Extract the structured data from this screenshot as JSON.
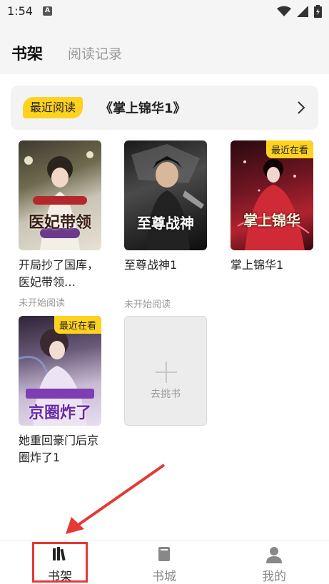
{
  "status_bar": {
    "time": "1:54",
    "notif_letter": "A"
  },
  "header": {
    "tab_active": "书架",
    "tab_inactive": "阅读记录"
  },
  "recent": {
    "badge": "最近阅读",
    "book_title": "《掌上锦华1》"
  },
  "books": [
    {
      "title": "开局抄了国库，医妃带领…",
      "status": "未开始阅读",
      "cover_text": "医妃带领",
      "badge": ""
    },
    {
      "title": "至尊战神1",
      "status": "未开始阅读",
      "cover_text": "至尊战神",
      "badge": ""
    },
    {
      "title": "掌上锦华1",
      "status": "",
      "cover_text": "掌上锦华",
      "badge": "最近在看"
    },
    {
      "title": "她重回豪门后京圈炸了1",
      "status": "",
      "cover_text": "京圈炸了",
      "badge": "最近在看"
    }
  ],
  "add_book": {
    "label": "去挑书"
  },
  "bottom_nav": [
    {
      "label": "书架"
    },
    {
      "label": "书城"
    },
    {
      "label": "我的"
    }
  ],
  "colors": {
    "accent": "#ffd21f",
    "highlight": "#e53935"
  }
}
